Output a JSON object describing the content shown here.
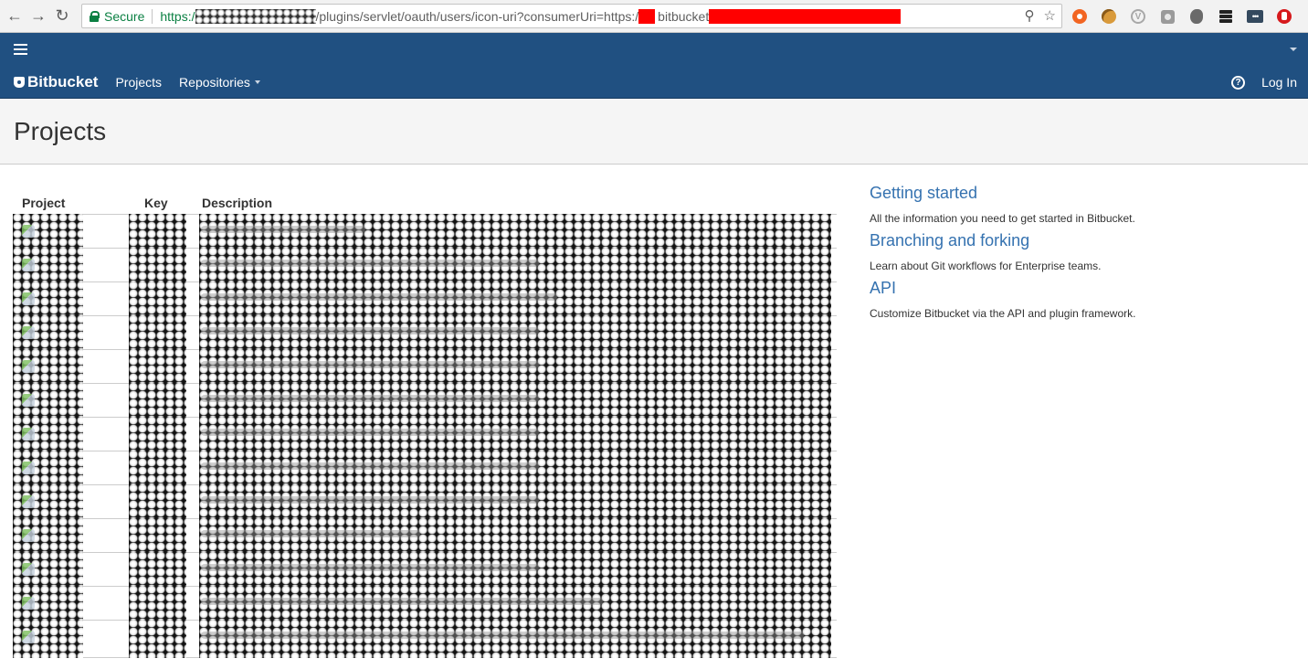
{
  "browser": {
    "secure_label": "Secure",
    "url": {
      "scheme": "https:/",
      "redacted_host": "[redacted]",
      "path": "/plugins/servlet/oauth/users/icon-uri?consumerUri=https:/",
      "after_red": "bitbucket"
    },
    "extensions": [
      "orange-circle-extension",
      "cookie-extension",
      "v-extension",
      "gray-square-extension",
      "evernote-extension",
      "buffer-stack-extension",
      "dots-extension",
      "adblock-hand-extension"
    ]
  },
  "header": {
    "brand": "Bitbucket",
    "nav": [
      {
        "label": "Projects"
      },
      {
        "label": "Repositories"
      }
    ],
    "login_label": "Log In",
    "colors": {
      "nav_bg": "#205081",
      "link": "#3572b0"
    }
  },
  "page": {
    "title": "Projects"
  },
  "table": {
    "columns": [
      "Project",
      "Key",
      "Description"
    ],
    "rows": [
      {
        "project": "[redacted]",
        "key": "[redacted]",
        "description": "[redacted]"
      },
      {
        "project": "[redacted]",
        "key": "[redacted]",
        "description": "[redacted]"
      },
      {
        "project": "[redacted]",
        "key": "[redacted]",
        "description": "[redacted]"
      },
      {
        "project": "[redacted]",
        "key": "[redacted]",
        "description": "[redacted]"
      },
      {
        "project": "[redacted]",
        "key": "[redacted]",
        "description": "[redacted]"
      },
      {
        "project": "[redacted]",
        "key": "[redacted]",
        "description": "[redacted]"
      },
      {
        "project": "[redacted]",
        "key": "[redacted]",
        "description": "[redacted]"
      },
      {
        "project": "[redacted]",
        "key": "[redacted]",
        "description": "[redacted]"
      },
      {
        "project": "[redacted]",
        "key": "[redacted]",
        "description": "[redacted]"
      },
      {
        "project": "[redacted]",
        "key": "[redacted]",
        "description": "[redacted]"
      },
      {
        "project": "[redacted]",
        "key": "[redacted]",
        "description": "[redacted]"
      },
      {
        "project": "[redacted]",
        "key": "[redacted]",
        "description": "[redacted]"
      },
      {
        "project": "[redacted]",
        "key": "[redacted]",
        "description": "[redacted]"
      }
    ]
  },
  "sidebar": {
    "items": [
      {
        "title": "Getting started",
        "description": "All the information you need to get started in Bitbucket."
      },
      {
        "title": "Branching and forking",
        "description": "Learn about Git workflows for Enterprise teams."
      },
      {
        "title": "API",
        "description": "Customize Bitbucket via the API and plugin framework."
      }
    ]
  }
}
